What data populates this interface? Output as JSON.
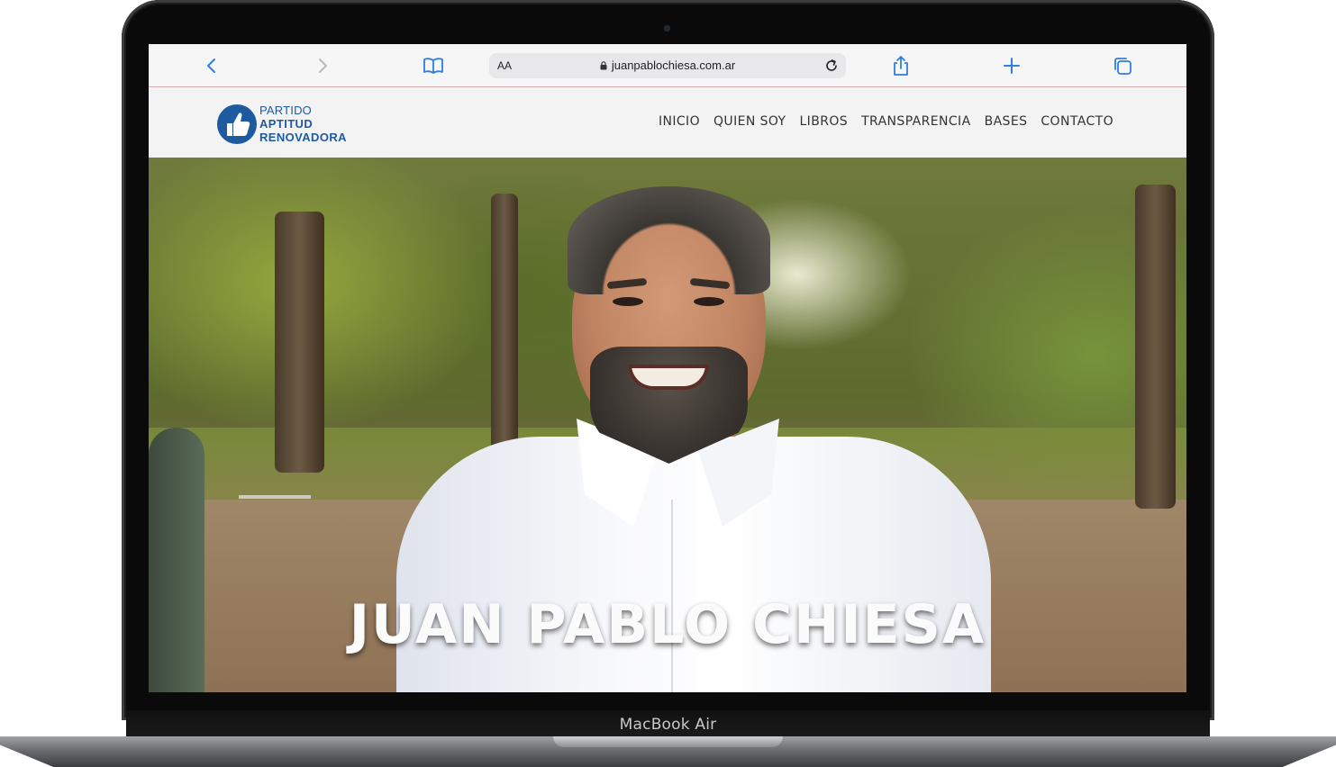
{
  "device": {
    "label": "MacBook Air"
  },
  "browser": {
    "text_size_label": "AA",
    "url": "juanpablochiesa.com.ar",
    "icons": [
      "back-icon",
      "forward-icon",
      "bookmarks-icon",
      "lock-icon",
      "reload-icon",
      "share-icon",
      "new-tab-icon",
      "tabs-icon"
    ]
  },
  "site": {
    "logo": {
      "line1": "PARTIDO",
      "line2": "APTITUD",
      "line3": "RENOVADORA",
      "color": "#1e5aa0"
    },
    "nav": [
      "INICIO",
      "QUIEN SOY",
      "LIBROS",
      "TRANSPARENCIA",
      "BASES",
      "CONTACTO"
    ],
    "hero": {
      "title": "JUAN PABLO CHIESA"
    }
  },
  "colors": {
    "accent": "#2f7ee0",
    "logo_blue": "#1e5aa0"
  }
}
